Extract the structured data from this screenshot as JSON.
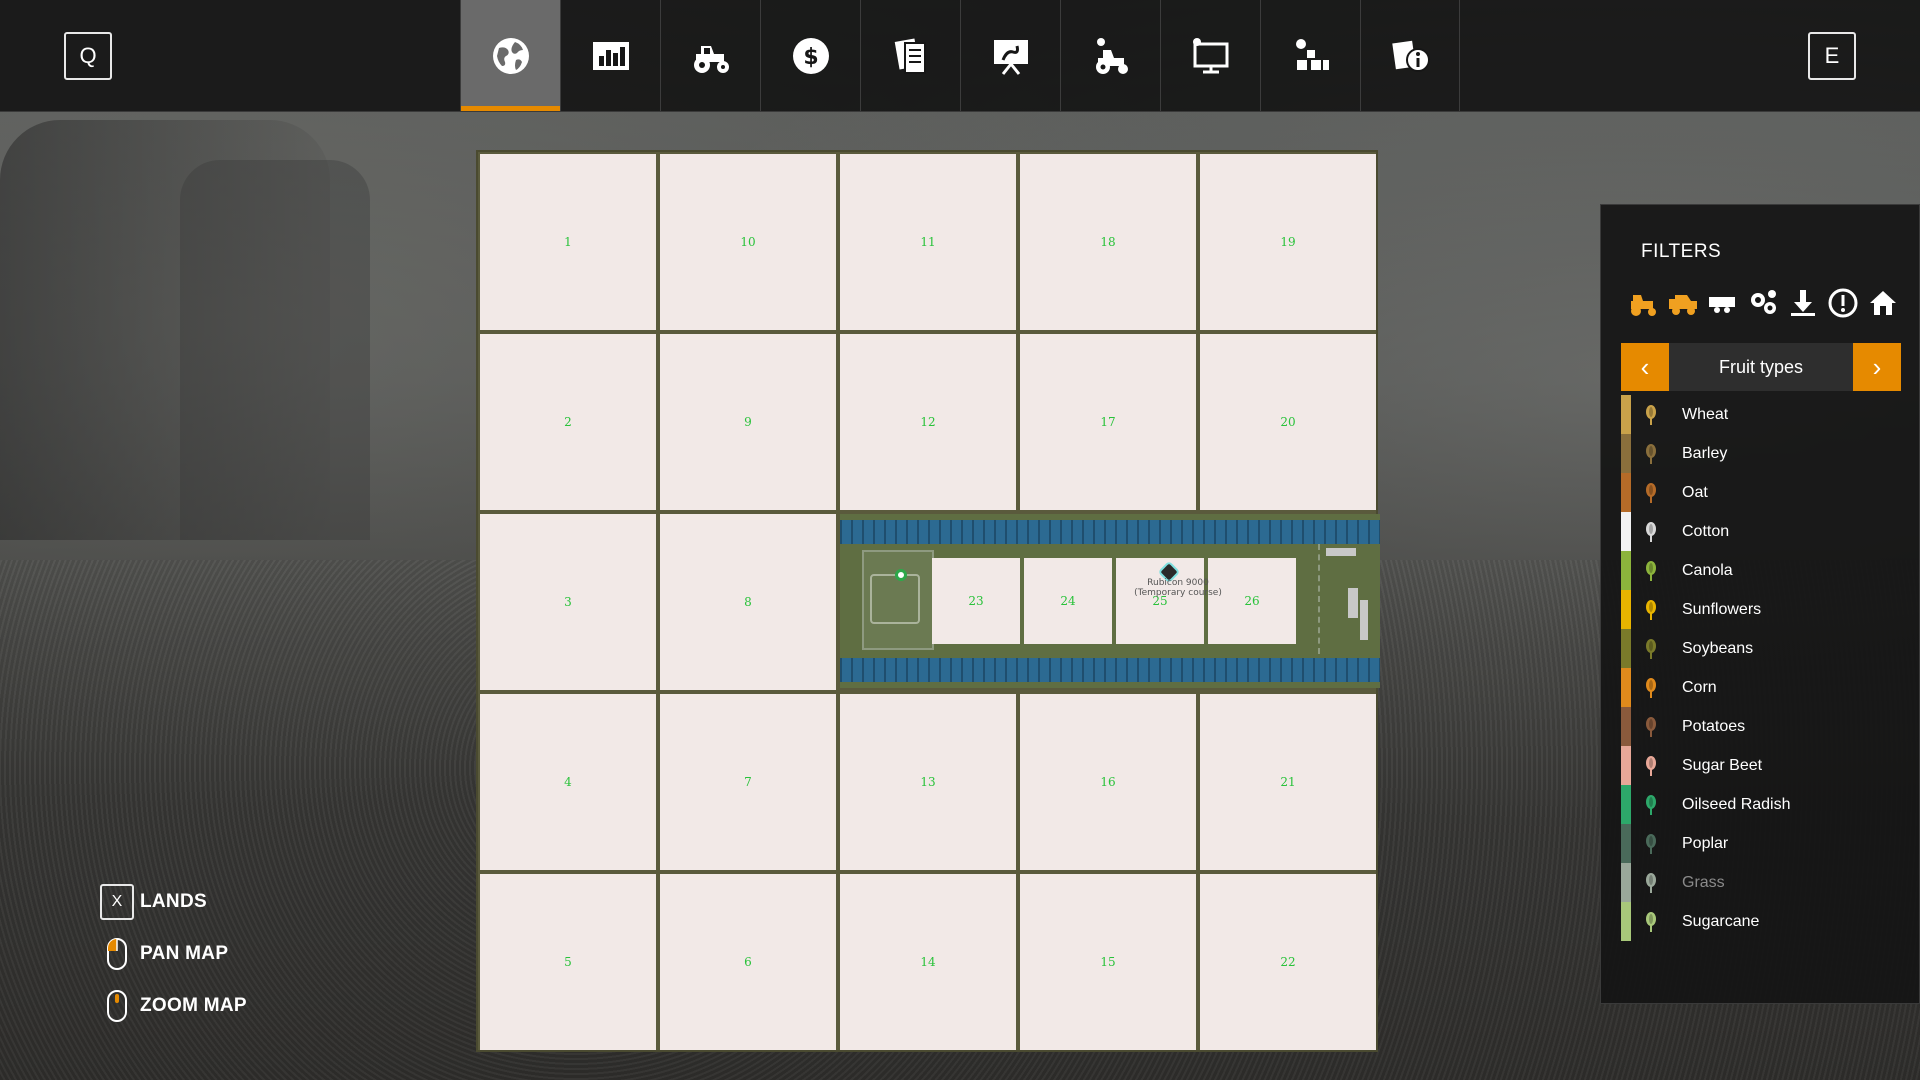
{
  "topbar": {
    "left_key": "Q",
    "right_key": "E",
    "tabs": [
      {
        "icon": "globe-icon",
        "active": true
      },
      {
        "icon": "bar-chart-icon",
        "active": false
      },
      {
        "icon": "tractor-icon",
        "active": false
      },
      {
        "icon": "dollar-icon",
        "active": false
      },
      {
        "icon": "contracts-icon",
        "active": false
      },
      {
        "icon": "presentation-icon",
        "active": false
      },
      {
        "icon": "workers-icon",
        "active": false
      },
      {
        "icon": "monitor-icon",
        "active": false
      },
      {
        "icon": "production-icon",
        "active": false
      },
      {
        "icon": "help-info-icon",
        "active": false
      }
    ]
  },
  "map": {
    "land_numbers": [
      "1",
      "10",
      "11",
      "18",
      "19",
      "2",
      "9",
      "12",
      "17",
      "20",
      "3",
      "8",
      "4",
      "7",
      "13",
      "16",
      "21",
      "5",
      "6",
      "14",
      "15",
      "22"
    ],
    "field_numbers": [
      "23",
      "24",
      "25",
      "26"
    ],
    "vehicle_label": "Rubicon 9000 (Temporary course)"
  },
  "filters": {
    "title": "FILTERS",
    "icons": [
      "tractor-filter-icon",
      "combine-filter-icon",
      "trailer-filter-icon",
      "tools-filter-icon",
      "sell-point-icon",
      "warning-icon",
      "farmhouse-icon"
    ],
    "selector_label": "Fruit types",
    "fruits": [
      {
        "name": "Wheat",
        "color": "#c9a24a",
        "dim": false
      },
      {
        "name": "Barley",
        "color": "#8a6f3c",
        "dim": false
      },
      {
        "name": "Oat",
        "color": "#b56b28",
        "dim": false
      },
      {
        "name": "Cotton",
        "color": "#f2f2f2",
        "dim": false
      },
      {
        "name": "Canola",
        "color": "#8cb43c",
        "dim": false
      },
      {
        "name": "Sunflowers",
        "color": "#e8b400",
        "dim": false
      },
      {
        "name": "Soybeans",
        "color": "#7a7a2a",
        "dim": false
      },
      {
        "name": "Corn",
        "color": "#e08a1c",
        "dim": false
      },
      {
        "name": "Potatoes",
        "color": "#8a5a3c",
        "dim": false
      },
      {
        "name": "Sugar Beet",
        "color": "#e8a898",
        "dim": false
      },
      {
        "name": "Oilseed Radish",
        "color": "#2da86a",
        "dim": false
      },
      {
        "name": "Poplar",
        "color": "#4a6a5a",
        "dim": false
      },
      {
        "name": "Grass",
        "color": "#9aa89a",
        "dim": true
      },
      {
        "name": "Sugarcane",
        "color": "#a8c87a",
        "dim": false
      }
    ]
  },
  "controls": [
    {
      "key": "X",
      "label": "LANDS"
    },
    {
      "key": "",
      "label": "PAN MAP"
    },
    {
      "key": "",
      "label": "ZOOM MAP"
    }
  ]
}
